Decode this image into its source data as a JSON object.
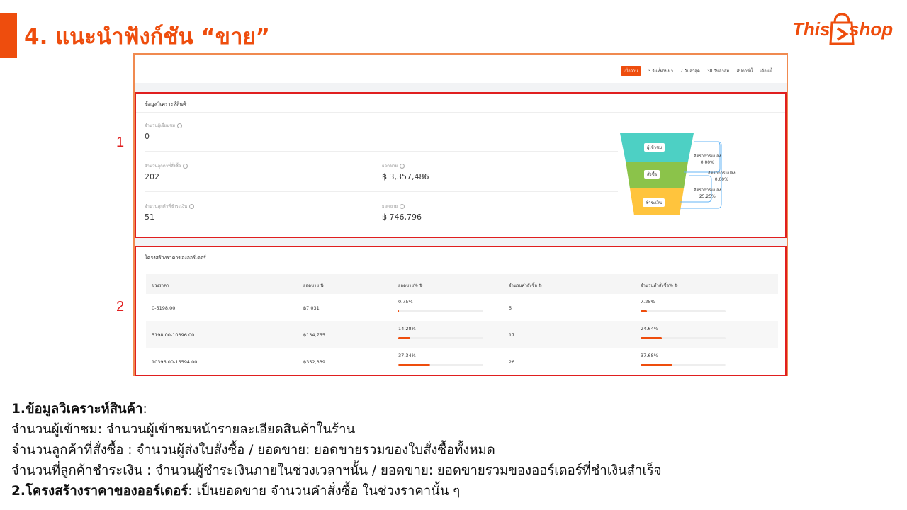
{
  "slide": {
    "title": "4. แนะนำฟังก์ชัน “ขาย”",
    "logo_this": "This",
    "logo_shop": "shop"
  },
  "time_range": {
    "tabs": [
      "เมื่อวาน",
      "3 วันที่ผ่านมา",
      "7 วันล่าสุด",
      "30 วันล่าสุด",
      "สัปดาห์นี้",
      "เดือนนี้"
    ],
    "active_index": 0
  },
  "analysis": {
    "title": "ข้อมูลวิเคราะห์สินค้า",
    "visitors_label": "จำนวนผู้เยี่ยมชม",
    "visitors_value": "0",
    "ordered_label": "จำนวนลูกค้าที่สั่งซื้อ",
    "ordered_value": "202",
    "ordered_sales_label": "ยอดขาย",
    "ordered_sales_value": "฿ 3,357,486",
    "paid_label": "จำนวนลูกค้าที่ชำระเงิน",
    "paid_value": "51",
    "paid_sales_label": "ยอดขาย",
    "paid_sales_value": "฿ 746,796",
    "funnel": {
      "stage_visit": "ผู้เข้าชม",
      "stage_order": "สั่งซื้อ",
      "stage_pay": "ชำระเงิน",
      "conv1_label": "อัตราการแปลง",
      "conv1_value": "0.00%",
      "conv2_label": "อัตราการแปลง",
      "conv2_value": "0.00%",
      "conv3_label": "อัตราการแปลง",
      "conv3_value": "25.25%",
      "colors": {
        "top": "#4dd0c4",
        "middle": "#8bc34a",
        "bottom": "#ffc43d",
        "arrow": "#64b5f6"
      }
    }
  },
  "price_structure": {
    "title": "โครงสร้างราคาของออร์เดอร์",
    "columns": [
      "ช่วงราคา",
      "ยอดขาย",
      "ยอดขาย%",
      "จำนวนคำสั่งซื้อ",
      "จำนวนคำสั่งซื้อ%"
    ],
    "rows": [
      {
        "range": "0-5198.00",
        "sales": "฿7,031",
        "sales_pct": "0.75%",
        "sales_pct_value": 0.75,
        "orders": "5",
        "orders_pct": "7.25%",
        "orders_pct_value": 7.25
      },
      {
        "range": "5198.00-10396.00",
        "sales": "฿134,755",
        "sales_pct": "14.28%",
        "sales_pct_value": 14.28,
        "orders": "17",
        "orders_pct": "24.64%",
        "orders_pct_value": 24.64
      },
      {
        "range": "10396.00-15594.00",
        "sales": "฿352,339",
        "sales_pct": "37.34%",
        "sales_pct_value": 37.34,
        "orders": "26",
        "orders_pct": "37.68%",
        "orders_pct_value": 37.68
      }
    ]
  },
  "callouts": {
    "one": "1",
    "two": "2"
  },
  "notes": {
    "line1_bold": "1.ข้อมูลวิเคราะห์สินค้า",
    "line1_rest": ":",
    "line2": "จำนวนผู้เข้าชม:  จำนวนผู้เข้าชมหน้ารายละเอียดสินค้าในร้าน",
    "line3": "จำนวนลูกค้าที่สั่งซื้อ :   จำนวนผู้ส่งใบสั่งซื้อ / ยอดขาย:  ยอดขายรวมของใบสั่งซื้อทั้งหมด",
    "line4": "จำนวนที่ลูกค้าชำระเงิน :   จำนวนผู้ชำระเงินภายในช่วงเวลาฯนั้น / ยอดขาย:   ยอดขายรวมของออร์เดอร์ที่ชำเงินสำเร็จ",
    "line5_bold": "2.โครงสร้างราคาของออร์เดอร์",
    "line5_rest": ":  เป็นยอดขาย จำนวนคำสั่งซื้อ ในช่วงราคานั้น ๆ"
  },
  "colors": {
    "accent": "#ee4d0d",
    "highlight_border": "#e01f1f"
  }
}
